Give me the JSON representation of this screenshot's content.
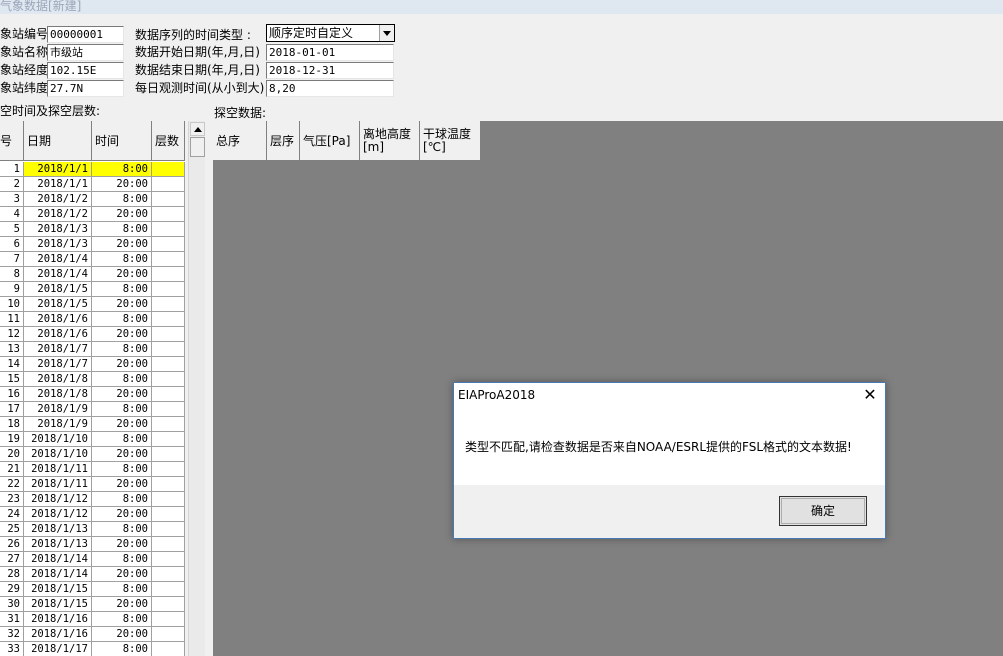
{
  "window": {
    "title": "气象数据[新建]"
  },
  "station": {
    "id_label": "象站编号",
    "id_value": "00000001",
    "name_label": "象站名称",
    "name_value": "市级站",
    "lon_label": "象站经度",
    "lon_value": "102.15E",
    "lat_label": "象站纬度",
    "lat_value": "27.7N"
  },
  "series": {
    "time_type_label": "数据序列的时间类型  :",
    "time_type_value": "顺序定时自定义",
    "start_label": "数据开始日期(年,月,日)",
    "start_value": "2018-01-01",
    "end_label": "数据结束日期(年,月,日)",
    "end_value": "2018-12-31",
    "obs_label": "每日观测时间(从小到大)",
    "obs_value": "8,20"
  },
  "left_grid": {
    "caption": "空时间及探空层数:",
    "headers": [
      "号",
      "日期",
      "时间",
      "层数"
    ],
    "rows": [
      [
        "1",
        "2018/1/1",
        "8:00",
        ""
      ],
      [
        "2",
        "2018/1/1",
        "20:00",
        ""
      ],
      [
        "3",
        "2018/1/2",
        "8:00",
        ""
      ],
      [
        "4",
        "2018/1/2",
        "20:00",
        ""
      ],
      [
        "5",
        "2018/1/3",
        "8:00",
        ""
      ],
      [
        "6",
        "2018/1/3",
        "20:00",
        ""
      ],
      [
        "7",
        "2018/1/4",
        "8:00",
        ""
      ],
      [
        "8",
        "2018/1/4",
        "20:00",
        ""
      ],
      [
        "9",
        "2018/1/5",
        "8:00",
        ""
      ],
      [
        "10",
        "2018/1/5",
        "20:00",
        ""
      ],
      [
        "11",
        "2018/1/6",
        "8:00",
        ""
      ],
      [
        "12",
        "2018/1/6",
        "20:00",
        ""
      ],
      [
        "13",
        "2018/1/7",
        "8:00",
        ""
      ],
      [
        "14",
        "2018/1/7",
        "20:00",
        ""
      ],
      [
        "15",
        "2018/1/8",
        "8:00",
        ""
      ],
      [
        "16",
        "2018/1/8",
        "20:00",
        ""
      ],
      [
        "17",
        "2018/1/9",
        "8:00",
        ""
      ],
      [
        "18",
        "2018/1/9",
        "20:00",
        ""
      ],
      [
        "19",
        "2018/1/10",
        "8:00",
        ""
      ],
      [
        "20",
        "2018/1/10",
        "20:00",
        ""
      ],
      [
        "21",
        "2018/1/11",
        "8:00",
        ""
      ],
      [
        "22",
        "2018/1/11",
        "20:00",
        ""
      ],
      [
        "23",
        "2018/1/12",
        "8:00",
        ""
      ],
      [
        "24",
        "2018/1/12",
        "20:00",
        ""
      ],
      [
        "25",
        "2018/1/13",
        "8:00",
        ""
      ],
      [
        "26",
        "2018/1/13",
        "20:00",
        ""
      ],
      [
        "27",
        "2018/1/14",
        "8:00",
        ""
      ],
      [
        "28",
        "2018/1/14",
        "20:00",
        ""
      ],
      [
        "29",
        "2018/1/15",
        "8:00",
        ""
      ],
      [
        "30",
        "2018/1/15",
        "20:00",
        ""
      ],
      [
        "31",
        "2018/1/16",
        "8:00",
        ""
      ],
      [
        "32",
        "2018/1/16",
        "20:00",
        ""
      ],
      [
        "33",
        "2018/1/17",
        "8:00",
        ""
      ]
    ]
  },
  "right_grid": {
    "caption": "探空数据:",
    "headers": [
      "总序",
      "层序",
      "气压[Pa]",
      "离地高度[m]",
      "干球温度[℃]"
    ]
  },
  "dialog": {
    "title": "EIAProA2018",
    "message": "类型不匹配,请检查数据是否来自NOAA/ESRL提供的FSL格式的文本数据!",
    "ok_label": "确定",
    "close_glyph": "✕"
  }
}
